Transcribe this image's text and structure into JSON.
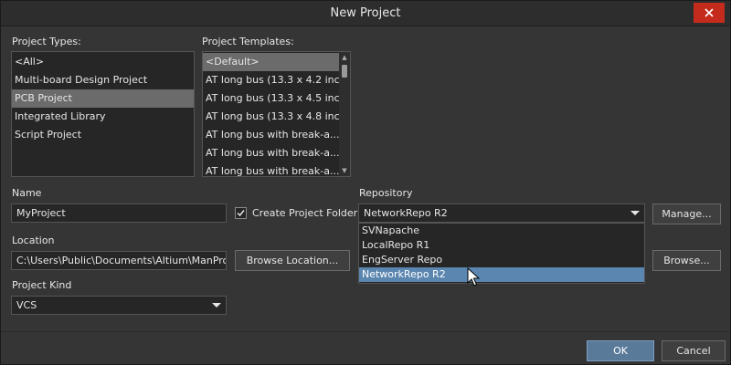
{
  "window": {
    "title": "New Project",
    "close_icon": "close-icon"
  },
  "project_types": {
    "label": "Project Types:",
    "items": [
      "<All>",
      "Multi-board Design Project",
      "PCB Project",
      "Integrated Library",
      "Script Project"
    ],
    "selected_index": 2
  },
  "project_templates": {
    "label": "Project Templates:",
    "items": [
      "<Default>",
      "AT long bus (13.3 x 4.2 inc...",
      "AT long bus (13.3 x 4.5 inc...",
      "AT long bus (13.3 x 4.8 inc...",
      "AT long bus with break-a...",
      "AT long bus with break-a...",
      "AT long bus with break-a..."
    ],
    "selected_index": 0
  },
  "name": {
    "label": "Name",
    "value": "MyProject"
  },
  "create_folder": {
    "label": "Create Project Folder",
    "checked": true
  },
  "location": {
    "label": "Location",
    "value": "C:\\Users\\Public\\Documents\\Altium\\ManProj",
    "browse_label": "Browse Location..."
  },
  "project_kind": {
    "label": "Project Kind",
    "value": "VCS"
  },
  "repository": {
    "label": "Repository",
    "value": "NetworkRepo R2",
    "options": [
      "SVNapache",
      "LocalRepo R1",
      "EngServer Repo",
      "NetworkRepo R2"
    ],
    "highlighted_index": 3,
    "manage_label": "Manage...",
    "browse_label": "Browse..."
  },
  "footer": {
    "ok_label": "OK",
    "cancel_label": "Cancel"
  },
  "colors": {
    "background": "#353535",
    "selection": "#6b6b6b",
    "highlight": "#5b86b0",
    "close": "#c42b1c",
    "primary_button": "#5a7a9a"
  }
}
